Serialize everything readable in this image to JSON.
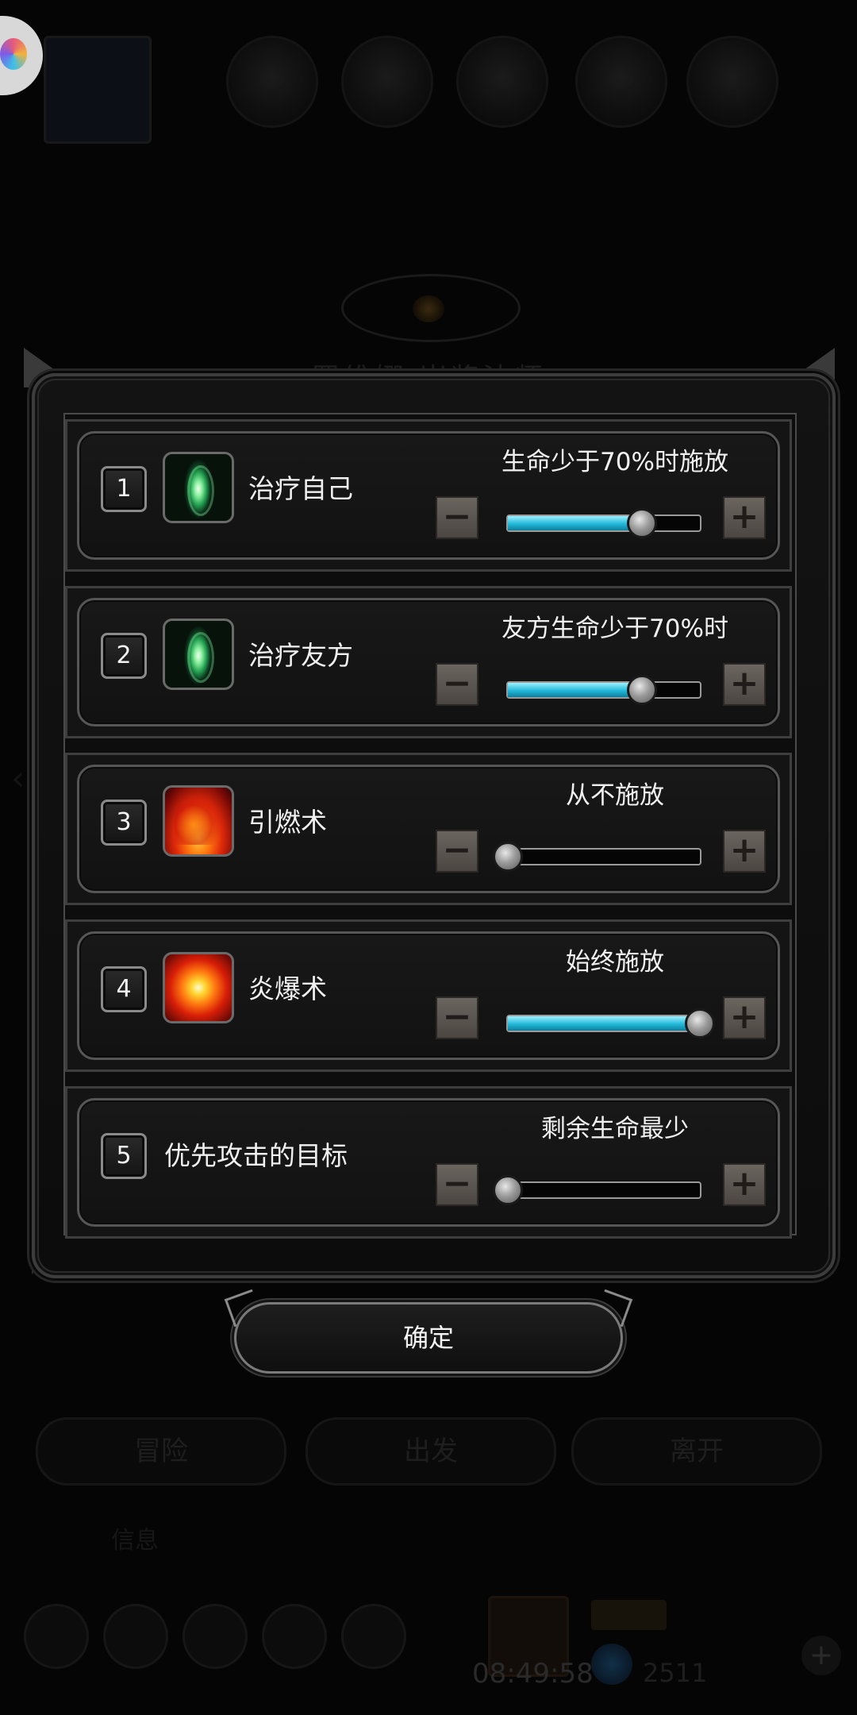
{
  "background": {
    "title": "罗维娜 岩浆法师",
    "buttons": [
      "冒险",
      "出发",
      "离开"
    ],
    "small_label": "信息",
    "clock": "08:49:58",
    "gem_count": "2511"
  },
  "dialog": {
    "rows": [
      {
        "number": "1",
        "icon": "heal-icon",
        "name": "治疗自己",
        "condition": "生命少于70%时施放",
        "slider_value": 0.7
      },
      {
        "number": "2",
        "icon": "heal-icon",
        "name": "治疗友方",
        "condition": "友方生命少于70%时",
        "slider_value": 0.7
      },
      {
        "number": "3",
        "icon": "fire-icon",
        "name": "引燃术",
        "condition": "从不施放",
        "slider_value": 0.0
      },
      {
        "number": "4",
        "icon": "blast-icon",
        "name": "炎爆术",
        "condition": "始终施放",
        "slider_value": 1.0
      },
      {
        "number": "5",
        "icon": "",
        "name": "优先攻击的目标",
        "condition": "剩余生命最少",
        "slider_value": 0.0
      }
    ],
    "minus_label": "−",
    "plus_label": "+",
    "confirm_label": "确定"
  },
  "colors": {
    "slider_fill": "#21b8d8",
    "button_face": "#5b5550"
  }
}
